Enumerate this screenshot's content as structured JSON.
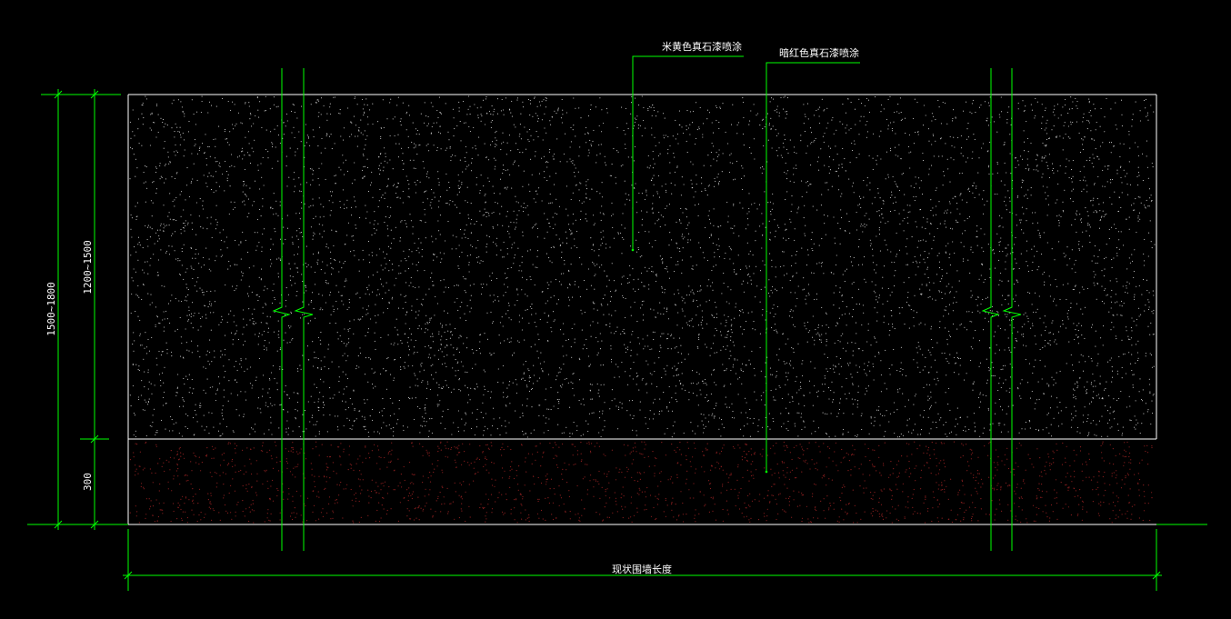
{
  "drawing": {
    "callout_top": "米黄色真石漆喷涂",
    "callout_bottom": "暗红色真石漆喷涂",
    "dim_total_height": "1500~1800",
    "dim_upper_height": "1200~1500",
    "dim_lower_height": "300",
    "dim_length": "现状围墙长度"
  },
  "colors": {
    "background": "#000000",
    "line_green": "#00ff00",
    "wall_outline": "#ffffff",
    "dots_upper": "#d8d8d8",
    "dots_lower": "#8a1f1f"
  }
}
